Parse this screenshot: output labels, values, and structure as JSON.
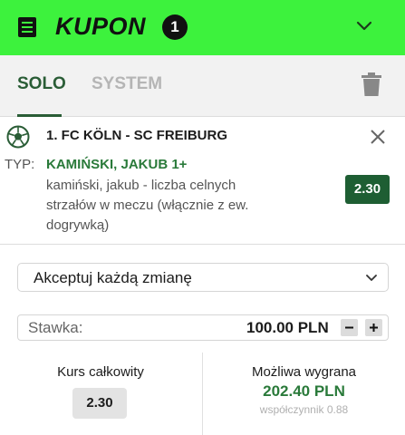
{
  "header": {
    "title": "KUPON",
    "count": "1",
    "bg_color": "#3df23d",
    "icons": {
      "coupon": "receipt-icon",
      "collapse": "chevron-down-icon"
    }
  },
  "tabs": [
    {
      "label": "SOLO",
      "active": true
    },
    {
      "label": "SYSTEM",
      "active": false
    }
  ],
  "toolbar": {
    "delete_icon": "trash-icon"
  },
  "bet": {
    "sport_icon": "football-icon",
    "match": "1. FC KÖLN - SC FREIBURG",
    "typ_label": "TYP:",
    "selection": "KAMIŃSKI, JAKUB 1+",
    "market": "kamiński, jakub - liczba celnych strzałów w meczu (włącznie z ew. dogrywką)",
    "odds": "2.30"
  },
  "accept_changes": {
    "selected": "Akceptuj każdą zmianę"
  },
  "stake": {
    "label": "Stawka:",
    "value": "100.00 PLN",
    "minus": "−",
    "plus": "+"
  },
  "summary": {
    "total_odds_label": "Kurs całkowity",
    "total_odds_value": "2.30",
    "possible_win_label": "Możliwa wygrana",
    "possible_win_value": "202.40 PLN",
    "coefficient": "współczynnik 0.88"
  },
  "colors": {
    "accent_green": "#2a5d36",
    "odds_green": "#1e5e33",
    "selection_green": "#2a7a3a"
  }
}
